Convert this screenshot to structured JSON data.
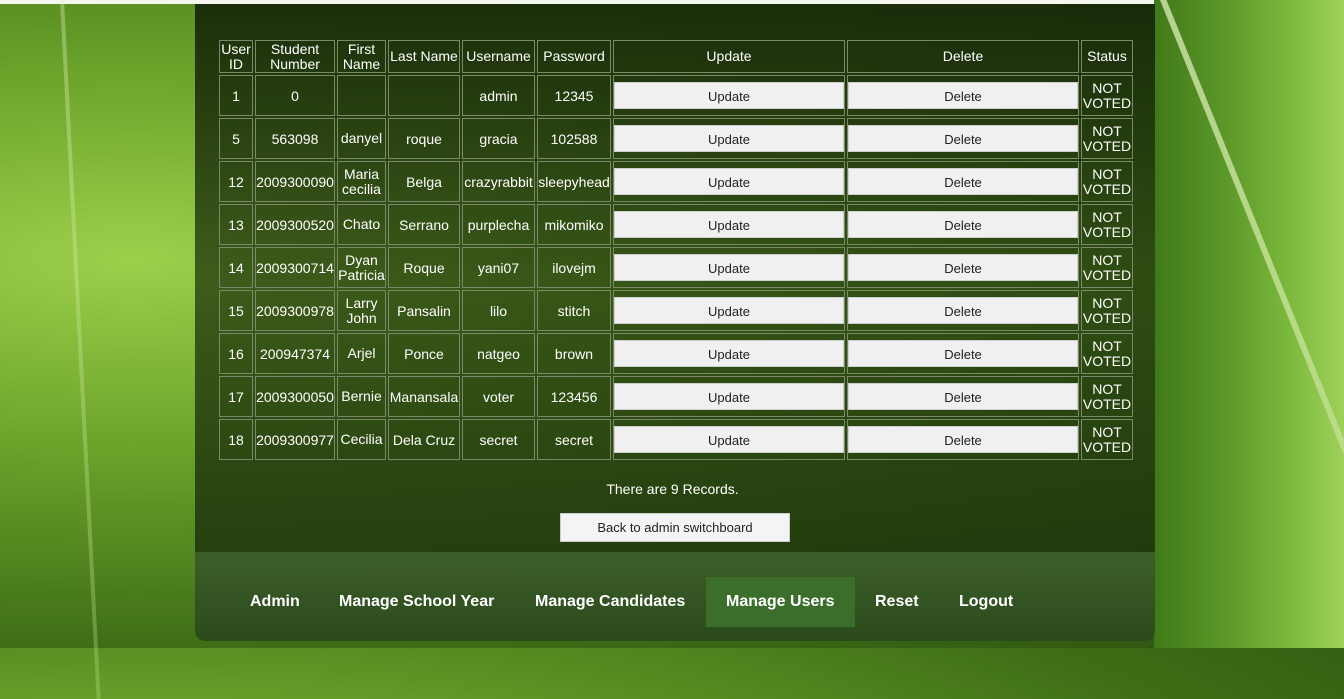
{
  "table": {
    "headers": {
      "user_id": "User ID",
      "student_number": "Student Number",
      "first_name": "First Name",
      "last_name": "Last Name",
      "username": "Username",
      "password": "Password",
      "update": "Update",
      "delete": "Delete",
      "status": "Status"
    },
    "rows": [
      {
        "id": "1",
        "student": "0",
        "first": "",
        "last": "",
        "username": "admin",
        "password": "12345",
        "update": "Update",
        "delete": "Delete",
        "status": "NOT VOTED"
      },
      {
        "id": "5",
        "student": "563098",
        "first": "danyel",
        "last": "roque",
        "username": "gracia",
        "password": "102588",
        "update": "Update",
        "delete": "Delete",
        "status": "NOT VOTED"
      },
      {
        "id": "12",
        "student": "2009300090",
        "first": "Maria cecilia",
        "last": "Belga",
        "username": "crazyrabbit",
        "password": "sleepyhead",
        "update": "Update",
        "delete": "Delete",
        "status": "NOT VOTED"
      },
      {
        "id": "13",
        "student": "2009300520",
        "first": "Chato",
        "last": "Serrano",
        "username": "purplecha",
        "password": "mikomiko",
        "update": "Update",
        "delete": "Delete",
        "status": "NOT VOTED"
      },
      {
        "id": "14",
        "student": "2009300714",
        "first": "Dyan Patricia",
        "last": "Roque",
        "username": "yani07",
        "password": "ilovejm",
        "update": "Update",
        "delete": "Delete",
        "status": "NOT VOTED"
      },
      {
        "id": "15",
        "student": "2009300978",
        "first": "Larry John",
        "last": "Pansalin",
        "username": "lilo",
        "password": "stitch",
        "update": "Update",
        "delete": "Delete",
        "status": "NOT VOTED"
      },
      {
        "id": "16",
        "student": "200947374",
        "first": "Arjel",
        "last": "Ponce",
        "username": "natgeo",
        "password": "brown",
        "update": "Update",
        "delete": "Delete",
        "status": "NOT VOTED"
      },
      {
        "id": "17",
        "student": "2009300050",
        "first": "Bernie",
        "last": "Manansala",
        "username": "voter",
        "password": "123456",
        "update": "Update",
        "delete": "Delete",
        "status": "NOT VOTED"
      },
      {
        "id": "18",
        "student": "2009300977",
        "first": "Cecilia",
        "last": "Dela Cruz",
        "username": "secret",
        "password": "secret",
        "update": "Update",
        "delete": "Delete",
        "status": "NOT VOTED"
      }
    ]
  },
  "records_text": "There are 9 Records.",
  "back_button": "Back to admin switchboard",
  "nav": {
    "items": [
      "Admin",
      "Manage School Year",
      "Manage Candidates",
      "Manage Users",
      "Reset",
      "Logout"
    ],
    "active": "Manage Users"
  },
  "colors": {
    "panel_bg": "#1e3410",
    "nav_bg": "#2b4a1c",
    "nav_active": "#3b6e2a",
    "button_bg": "#f0f0f0"
  }
}
